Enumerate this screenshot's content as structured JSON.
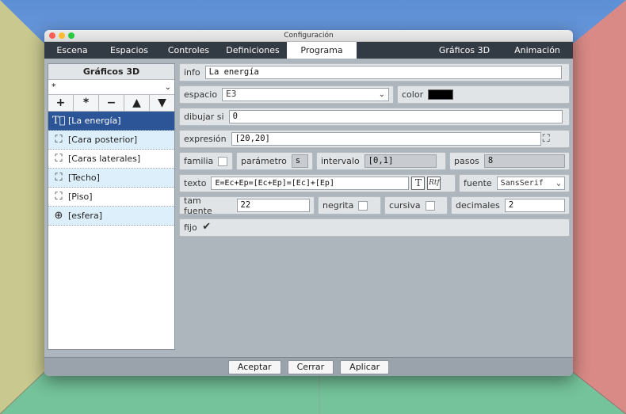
{
  "window": {
    "title": "Configuración"
  },
  "tabs": [
    {
      "label": "Escena"
    },
    {
      "label": "Espacios"
    },
    {
      "label": "Controles"
    },
    {
      "label": "Definiciones"
    },
    {
      "label": "Programa"
    },
    {
      "label": ""
    },
    {
      "label": "Gráficos 3D"
    },
    {
      "label": "Animación"
    }
  ],
  "active_tab": "Programa",
  "left": {
    "title": "Gráficos 3D",
    "filter_value": "*",
    "buttons": [
      "+",
      "*",
      "−",
      "▲",
      "▼"
    ],
    "items": [
      {
        "label": "[La energía]",
        "icon": "text-icon",
        "selected": true
      },
      {
        "label": "[Cara posterior]",
        "icon": "mesh-icon"
      },
      {
        "label": "[Caras laterales]",
        "icon": "mesh-icon"
      },
      {
        "label": "[Techo]",
        "icon": "mesh-icon"
      },
      {
        "label": "[Piso]",
        "icon": "mesh-icon"
      },
      {
        "label": "[esfera]",
        "icon": "sphere-icon"
      }
    ]
  },
  "form": {
    "info_label": "info",
    "info_value": "La energía",
    "espacio_label": "espacio",
    "espacio_value": "E3",
    "color_label": "color",
    "color_value": "#000000",
    "dibujar_label": "dibujar si",
    "dibujar_value": "0",
    "expresion_label": "expresión",
    "expresion_value": "[20,20]",
    "familia_label": "familia",
    "parametro_label": "parámetro",
    "parametro_value": "s",
    "intervalo_label": "intervalo",
    "intervalo_value": "[0,1]",
    "pasos_label": "pasos",
    "pasos_value": "8",
    "texto_label": "texto",
    "texto_value": "E=Ec+Ep=[Ec+Ep]=[Ec]+[Ep]",
    "fuente_label": "fuente",
    "fuente_value": "SansSerif",
    "tamfuente_label": "tam fuente",
    "tamfuente_value": "22",
    "negrita_label": "negrita",
    "cursiva_label": "cursiva",
    "decimales_label": "decimales",
    "decimales_value": "2",
    "fijo_label": "fijo",
    "fijo_mark": "✔",
    "text_button": "T",
    "rtf_button": "Rtf"
  },
  "footer": {
    "accept": "Aceptar",
    "close": "Cerrar",
    "apply": "Aplicar"
  }
}
